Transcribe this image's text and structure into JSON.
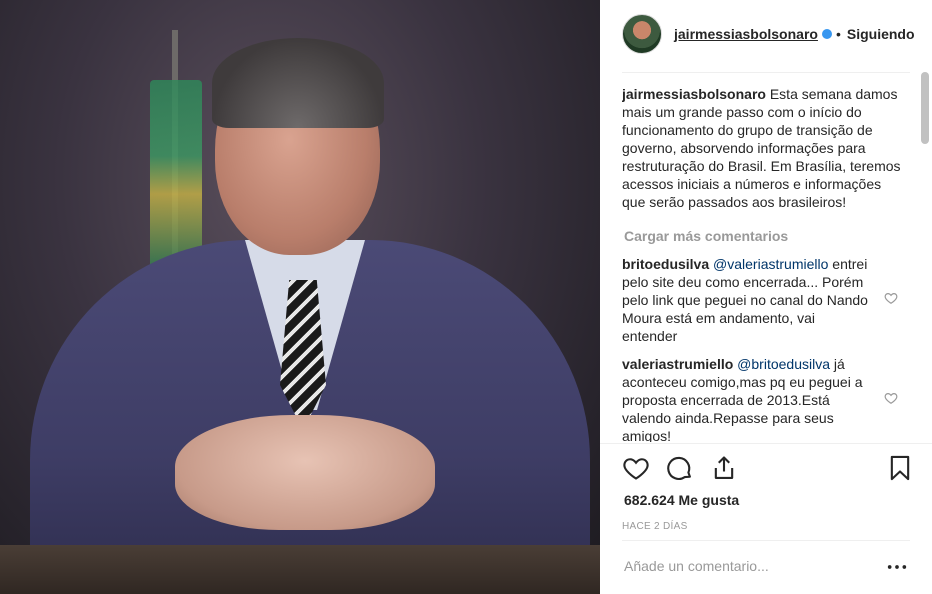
{
  "post": {
    "username": "jairmessiasbolsonaro",
    "verified_icon": "verified-badge-icon",
    "separator": "•",
    "follow_status": "Siguiendo"
  },
  "caption": {
    "username": "jairmessiasbolsonaro",
    "text": "Esta semana damos mais um grande passo com o início do funcionamento do grupo de transição de governo, absorvendo informações para restruturação do Brasil. Em Brasília, teremos acessos iniciais a números e informações que serão passados aos brasileiros!"
  },
  "load_more": "Cargar más comentarios",
  "comments": [
    {
      "username": "britoedusilva",
      "mention": "@valeriastrumiello",
      "text": "entrei pelo site deu como encerrada... Porém pelo link que peguei no canal do Nando Moura está em andamento, vai entender"
    },
    {
      "username": "valeriastrumiello",
      "mention": "@britoedusilva",
      "text": "já aconteceu comigo,mas pq eu peguei a proposta encerrada de 2013.Está valendo ainda.Repasse para seus amigos!"
    }
  ],
  "actions": {
    "like_icon": "heart-icon",
    "comment_icon": "comment-bubble-icon",
    "share_icon": "share-icon",
    "save_icon": "bookmark-icon"
  },
  "likes": "682.624 Me gusta",
  "time": "HACE 2 DÍAS",
  "add_comment_placeholder": "Añade un comentario...",
  "more_icon": "more-options-icon",
  "colors": {
    "link": "#003569",
    "muted": "#999999",
    "verified": "#3897f0",
    "text": "#262626"
  }
}
